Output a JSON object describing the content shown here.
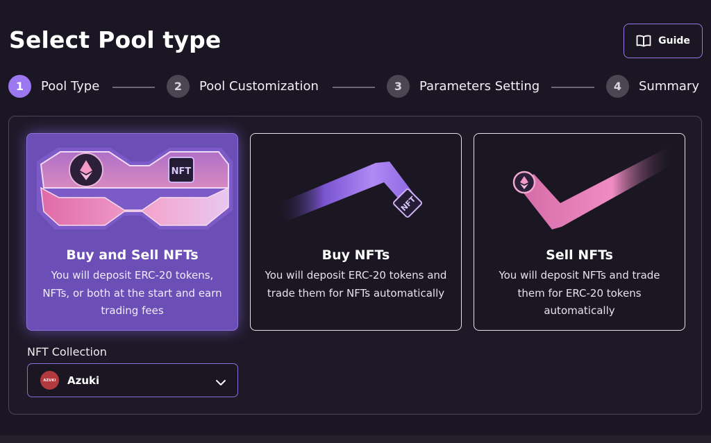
{
  "header": {
    "title": "Select Pool type",
    "guide_label": "Guide"
  },
  "steps": [
    {
      "number": "1",
      "label": "Pool Type",
      "active": true
    },
    {
      "number": "2",
      "label": "Pool Customization",
      "active": false
    },
    {
      "number": "3",
      "label": "Parameters Setting",
      "active": false
    },
    {
      "number": "4",
      "label": "Summary",
      "active": false
    }
  ],
  "pool_types": [
    {
      "title": "Buy and Sell NFTs",
      "description": "You will deposit ERC-20 tokens, NFTs, or both at the start and earn trading fees",
      "selected": true,
      "badge": "NFT"
    },
    {
      "title": "Buy NFTs",
      "description": "You will deposit ERC-20 tokens and trade them for NFTs automatically",
      "selected": false,
      "badge": "NFT"
    },
    {
      "title": "Sell NFTs",
      "description": "You will deposit NFTs and trade them for ERC-20 tokens automatically",
      "selected": false
    }
  ],
  "nft_collection": {
    "label": "NFT Collection",
    "selected": "Azuki",
    "logo_text": "AZUKI"
  },
  "colors": {
    "accent": "#9c78f0",
    "selected_card": "#6b4fb6",
    "background": "#1a1623"
  }
}
